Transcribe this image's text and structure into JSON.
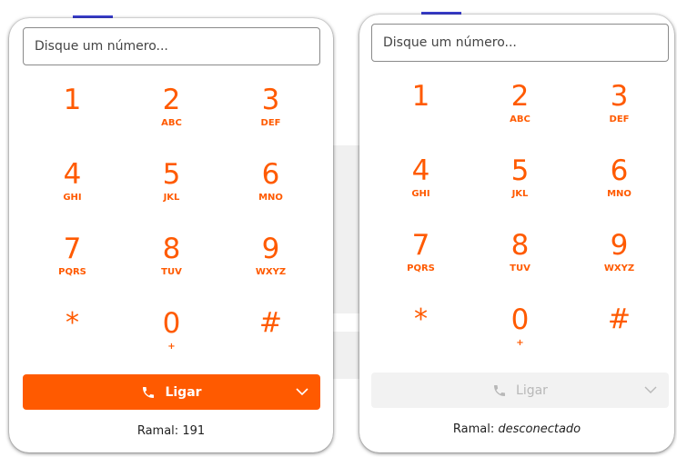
{
  "dialers": [
    {
      "input_placeholder": "Disque um número...",
      "keys": [
        {
          "digit": "1",
          "letters": ""
        },
        {
          "digit": "2",
          "letters": "ABC"
        },
        {
          "digit": "3",
          "letters": "DEF"
        },
        {
          "digit": "4",
          "letters": "GHI"
        },
        {
          "digit": "5",
          "letters": "JKL"
        },
        {
          "digit": "6",
          "letters": "MNO"
        },
        {
          "digit": "7",
          "letters": "PQRS"
        },
        {
          "digit": "8",
          "letters": "TUV"
        },
        {
          "digit": "9",
          "letters": "WXYZ"
        },
        {
          "digit": "*",
          "letters": ""
        },
        {
          "digit": "0",
          "letters": "+"
        },
        {
          "digit": "#",
          "letters": ""
        }
      ],
      "call_label": "Ligar",
      "call_enabled": true,
      "ramal_label": "Ramal:",
      "ramal_value": "191"
    },
    {
      "input_placeholder": "Disque um número...",
      "keys": [
        {
          "digit": "1",
          "letters": ""
        },
        {
          "digit": "2",
          "letters": "ABC"
        },
        {
          "digit": "3",
          "letters": "DEF"
        },
        {
          "digit": "4",
          "letters": "GHI"
        },
        {
          "digit": "5",
          "letters": "JKL"
        },
        {
          "digit": "6",
          "letters": "MNO"
        },
        {
          "digit": "7",
          "letters": "PQRS"
        },
        {
          "digit": "8",
          "letters": "TUV"
        },
        {
          "digit": "9",
          "letters": "WXYZ"
        },
        {
          "digit": "*",
          "letters": ""
        },
        {
          "digit": "0",
          "letters": "+"
        },
        {
          "digit": "#",
          "letters": ""
        }
      ],
      "call_label": "Ligar",
      "call_enabled": false,
      "ramal_label": "Ramal:",
      "ramal_value": "desconectado"
    }
  ],
  "icons": {
    "call": "phone-icon",
    "dropdown": "chevron-down-icon"
  },
  "colors": {
    "accent": "#ff5a00",
    "disabled_bg": "#f2f2f2",
    "disabled_text": "#b8b8b8",
    "background_tab": "#3b3fd1"
  }
}
